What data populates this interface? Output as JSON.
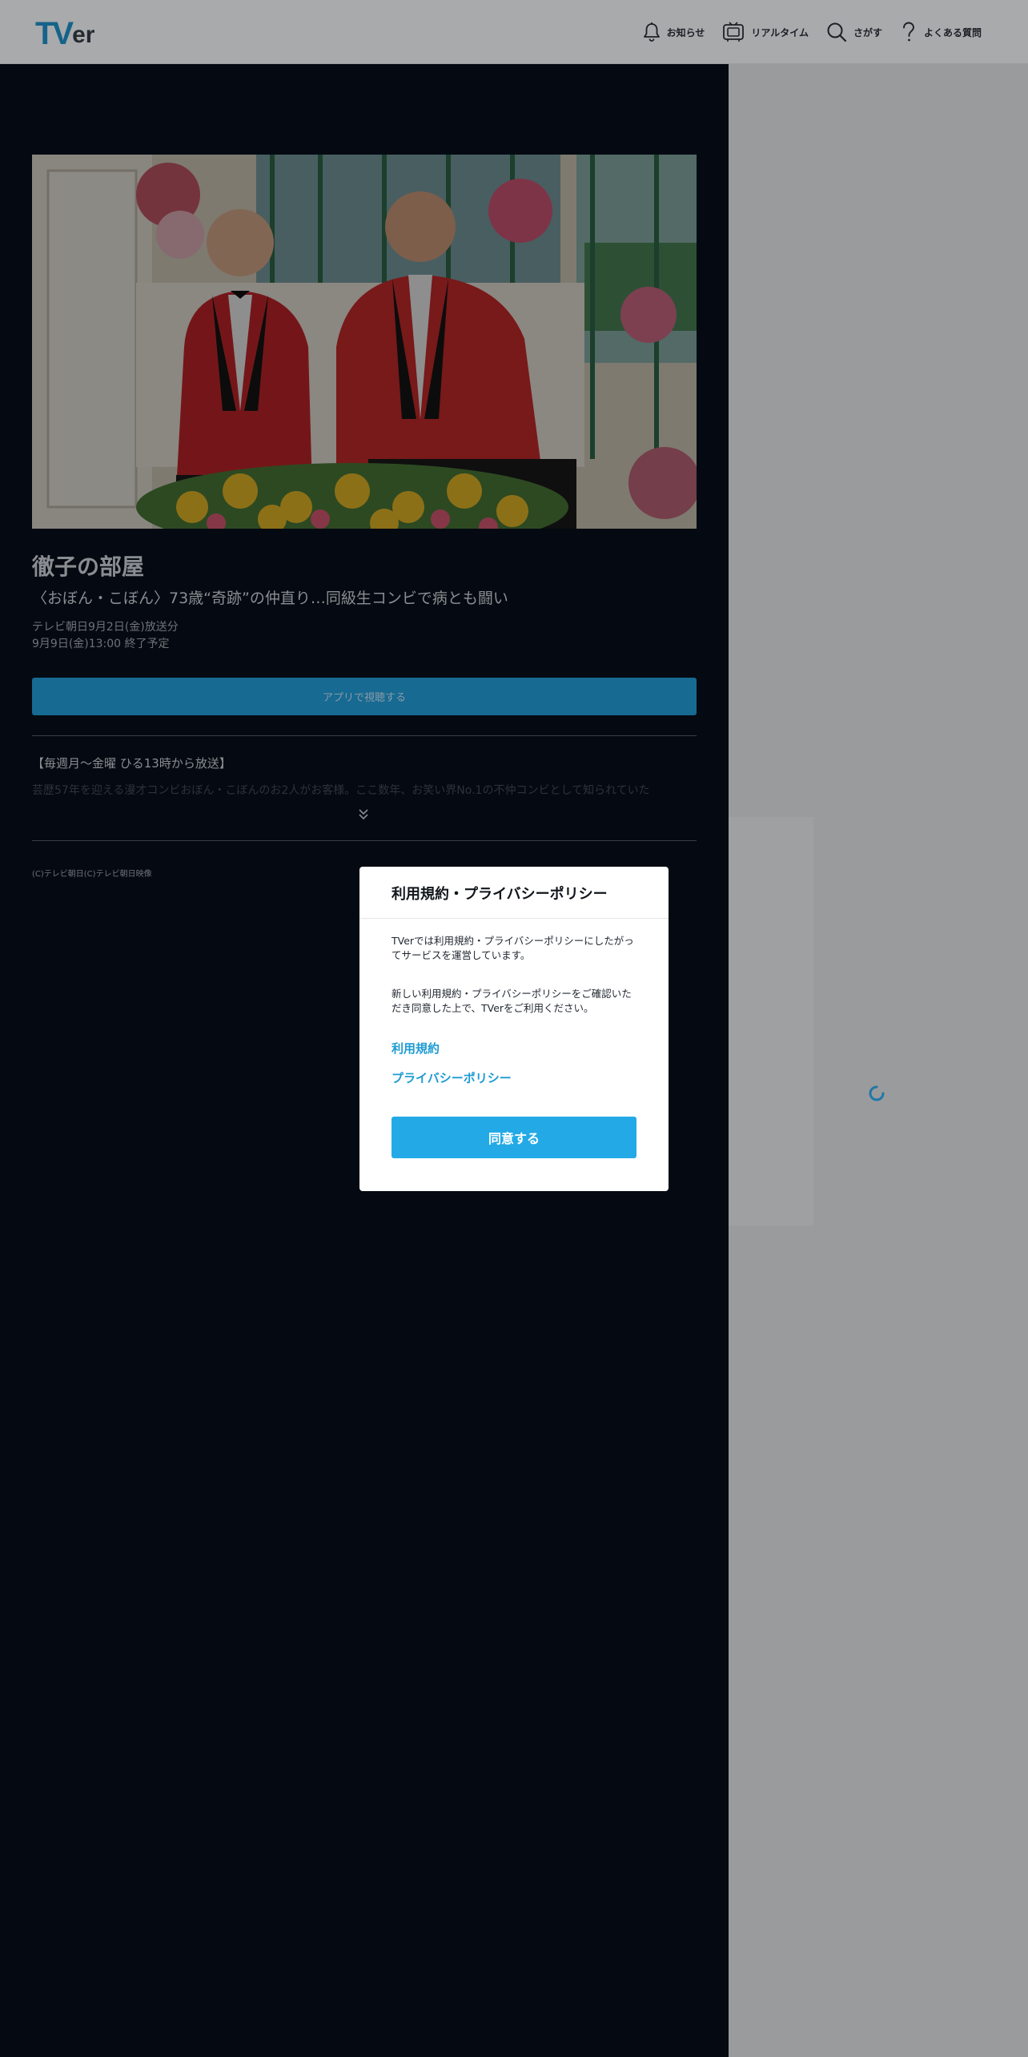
{
  "header": {
    "logo_tv": "TV",
    "logo_er": "er",
    "nav": [
      {
        "label": "お知らせ",
        "icon": "bell-icon"
      },
      {
        "label": "リアルタイム",
        "icon": "tv-icon"
      },
      {
        "label": "さがす",
        "icon": "search-icon"
      },
      {
        "label": "よくある質問",
        "icon": "question-icon"
      }
    ]
  },
  "program": {
    "series_title": "徹子の部屋",
    "episode_title": "〈おぼん・こぼん〉73歳“奇跡”の仲直り…同級生コンビで病とも闘い",
    "broadcast_info": "テレビ朝日9月2日(金)放送分",
    "end_info": "9月9日(金)13:00 終了予定",
    "app_button": "アプリで視聴する",
    "broadcast_note": "【毎週月～金曜 ひる13時から放送】",
    "description_preview": "芸歴57年を迎える漫才コンビおぼん・こぼんのお2人がお客様。ここ数年、お笑い界No.1の不仲コンビとして知られていた",
    "copyright": "(C)テレビ朝日(C)テレビ朝日映像"
  },
  "modal": {
    "title": "利用規約・プライバシーポリシー",
    "text1": "TVerでは利用規約・プライバシーポリシーにしたがってサービスを運営しています。",
    "text2": "新しい利用規約・プライバシーポリシーをご確認いただき同意した上で、TVerをご利用ください。",
    "link_terms": "利用規約",
    "link_privacy": "プライバシーポリシー",
    "agree_button": "同意する"
  },
  "colors": {
    "accent": "#23aae6",
    "panel_bg": "#050a12",
    "overlay": "#9a9b9c"
  }
}
